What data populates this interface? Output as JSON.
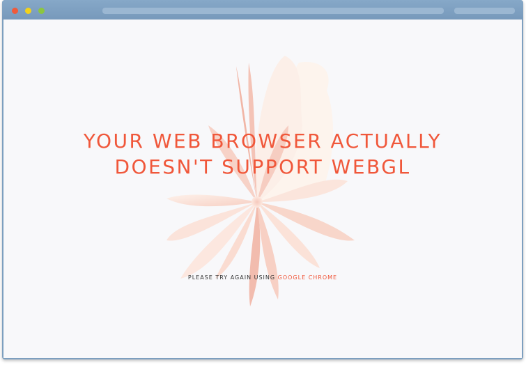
{
  "window": {
    "controls": {
      "close_color": "#f05a3a",
      "minimize_color": "#f3d21a",
      "maximize_color": "#8cc63f"
    }
  },
  "page": {
    "headline_line1": "YOUR WEB BROWSER ACTUALLY",
    "headline_line2": "DOESN'T SUPPORT WEBGL",
    "subline_text": "PLEASE TRY AGAIN USING",
    "subline_link": "GOOGLE CHROME",
    "accent_color": "#f0573a",
    "background_color": "#f8f8fa",
    "illustration": "flower-petals-image"
  }
}
